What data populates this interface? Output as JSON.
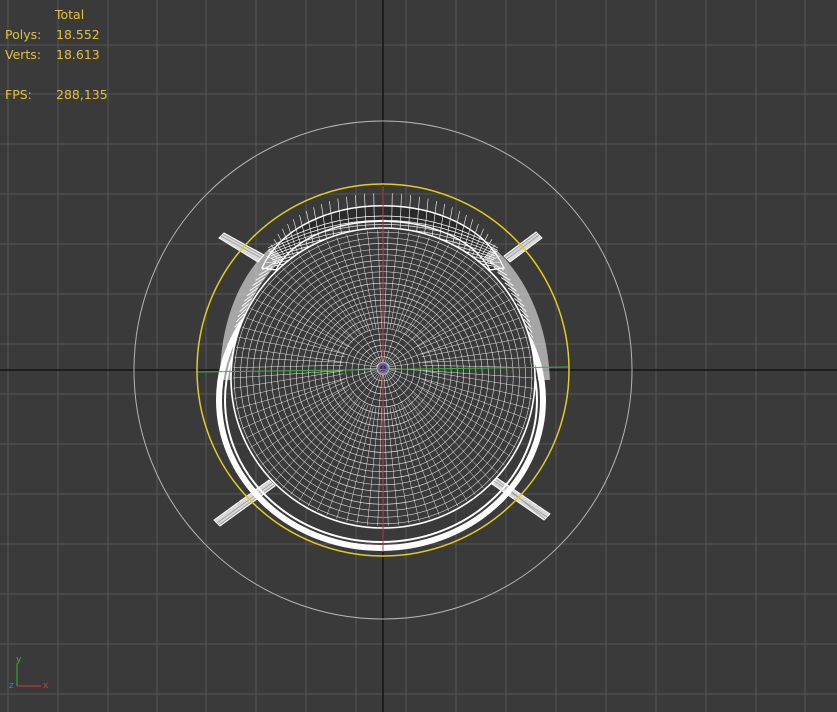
{
  "viewport": {
    "background": "#3a3a3a",
    "grid_color": "#555555",
    "world_axis_color": "#0a0a0a",
    "selection_color": "#e3cc21",
    "wire_color": "#ffffff",
    "guide_circle_color": "#b4b4b4"
  },
  "stats": {
    "header": "Total",
    "polys_label": "Polys:",
    "polys_value": "18.552",
    "verts_label": "Verts:",
    "verts_value": "18.613",
    "fps_label": "FPS:",
    "fps_value": "288,135",
    "text_color": "#e2c23a"
  },
  "model": {
    "icon": "wireframe-chair-icon",
    "x_axis_color": "#c83c3c",
    "y_axis_color": "#3cb43c",
    "pivot_color": "#6060d8"
  },
  "axis_gizmo": {
    "y_label": "y",
    "x_label": "x",
    "z_label": "z",
    "x_color": "#cc3b3b",
    "y_color": "#3bb33b",
    "z_color": "#5a6fd6"
  }
}
